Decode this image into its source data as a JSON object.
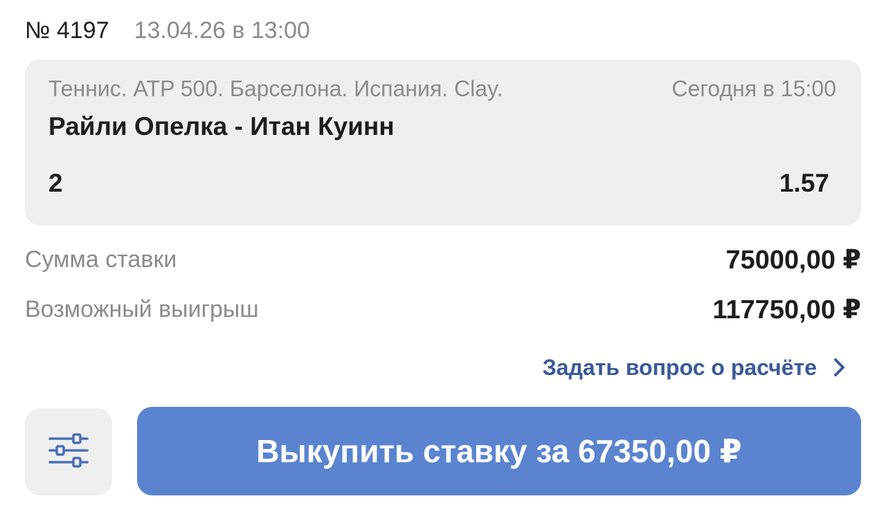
{
  "bet": {
    "number": "№ 4197",
    "date": "13.04.26 в 13:00"
  },
  "event": {
    "league": "Теннис. ATP 500. Барселона. Испания. Clay.",
    "time": "Сегодня в 15:00",
    "teams": "Райли Опелка - Итан Куинн",
    "outcome": "2",
    "odds": "1.57"
  },
  "summary": {
    "stake_label": "Сумма ставки",
    "stake_value": "75000,00 ₽",
    "win_label": "Возможный выигрыш",
    "win_value": "117750,00 ₽"
  },
  "actions": {
    "question_link": "Задать вопрос о расчёте",
    "cashout_label": "Выкупить ставку за 67350,00 ₽"
  },
  "icons": {
    "settings": "sliders-icon",
    "chevron": "chevron-right-icon"
  },
  "colors": {
    "accent": "#5b84d0",
    "link": "#3a5a98",
    "card_bg": "#efefef",
    "muted_text": "#8b8b8b",
    "primary_text": "#1e1e1e"
  }
}
